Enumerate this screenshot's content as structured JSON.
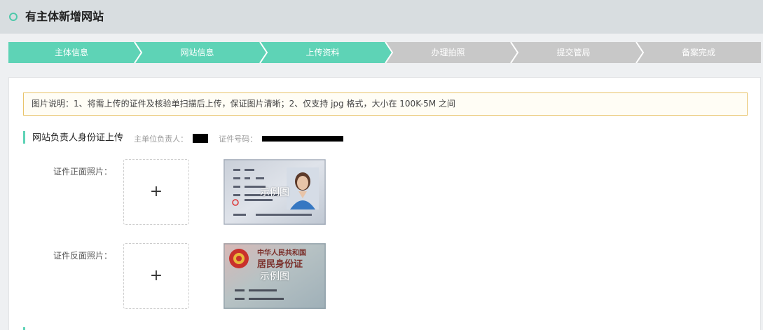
{
  "header": {
    "title": "有主体新增网站"
  },
  "steps": [
    {
      "label": "主体信息",
      "state": "done"
    },
    {
      "label": "网站信息",
      "state": "done"
    },
    {
      "label": "上传资料",
      "state": "current"
    },
    {
      "label": "办理拍照",
      "state": "todo"
    },
    {
      "label": "提交管局",
      "state": "todo"
    },
    {
      "label": "备案完成",
      "state": "todo"
    }
  ],
  "colors": {
    "accent": "#5ed3b6",
    "inactive_step": "#c8c8c8",
    "notice_border": "#e9c46a"
  },
  "notice": {
    "text": "图片说明：1、将需上传的证件及核验单扫描后上传，保证图片清晰；2、仅支持 jpg 格式，大小在 100K-5M 之间"
  },
  "section": {
    "title": "网站负责人身份证上传",
    "owner_label": "主单位负责人：",
    "id_label": "证件号码："
  },
  "uploads": {
    "front": {
      "label": "证件正面照片：",
      "button": "+",
      "sample_caption": "示例图"
    },
    "back": {
      "label": "证件反面照片：",
      "button": "+",
      "sample_caption": "示例图",
      "card_title": "中华人民共和国",
      "card_subtitle": "居民身份证"
    }
  },
  "icons": {
    "header": "circle-icon",
    "upload": "plus-icon"
  }
}
